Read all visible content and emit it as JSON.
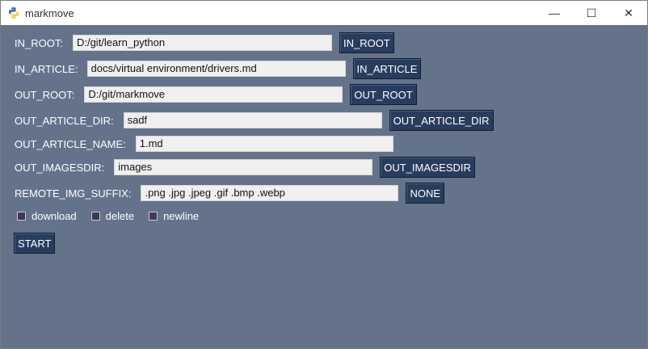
{
  "window": {
    "title": "markmove",
    "controls": {
      "minimize": "—",
      "maximize": "☐",
      "close": "✕"
    }
  },
  "fields": [
    {
      "label": "IN_ROOT:",
      "value": "D:/git/learn_python",
      "button": "IN_ROOT"
    },
    {
      "label": "IN_ARTICLE:",
      "value": "docs/virtual environment/drivers.md",
      "button": "IN_ARTICLE"
    },
    {
      "label": "OUT_ROOT:",
      "value": "D:/git/markmove",
      "button": "OUT_ROOT"
    },
    {
      "label": "OUT_ARTICLE_DIR:",
      "value": "sadf",
      "button": "OUT_ARTICLE_DIR"
    },
    {
      "label": "OUT_ARTICLE_NAME:",
      "value": "1.md"
    },
    {
      "label": "OUT_IMAGESDIR:",
      "value": "images",
      "button": "OUT_IMAGESDIR"
    },
    {
      "label": "REMOTE_IMG_SUFFIX:",
      "value": ".png .jpg .jpeg .gif .bmp .webp",
      "button": "NONE"
    }
  ],
  "options": [
    {
      "label": "download",
      "checked": false
    },
    {
      "label": "delete",
      "checked": false
    },
    {
      "label": "newline",
      "checked": false
    }
  ],
  "start_button": "START",
  "colors": {
    "background": "#64738a",
    "button": "#283d5e",
    "field": "#f0f0f0",
    "titlebar": "#ffffff"
  },
  "icons": {
    "app": "python-logo-icon"
  }
}
